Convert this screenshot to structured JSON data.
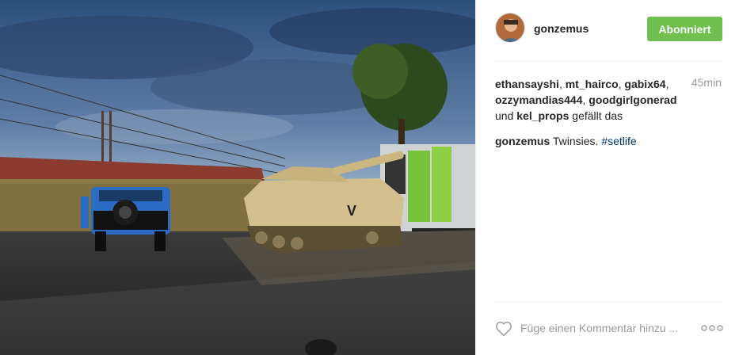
{
  "post": {
    "image_alt": "Tank and blue SUV parked in a lot under a cloudy sky"
  },
  "header": {
    "username": "gonzemus",
    "follow_label": "Abonniert",
    "avatar_icon": "profile-avatar"
  },
  "likes": {
    "users": [
      "ethansayshi",
      "mt_hairco",
      "gabix64",
      "ozzymandias444",
      "goodgirlgonerad",
      "kel_props"
    ],
    "separator": ", ",
    "conjunction": " und ",
    "suffix": " gefällt das",
    "time": "45min"
  },
  "caption": {
    "username": "gonzemus",
    "text": "Twinsies.",
    "hashtag": "#setlife"
  },
  "comment": {
    "placeholder": "Füge einen Kommentar hinzu ...",
    "like_icon": "heart-icon",
    "more_icon": "more-options-icon"
  },
  "colors": {
    "follow_button": "#70c050",
    "hashtag": "#003569",
    "muted": "#999999"
  }
}
